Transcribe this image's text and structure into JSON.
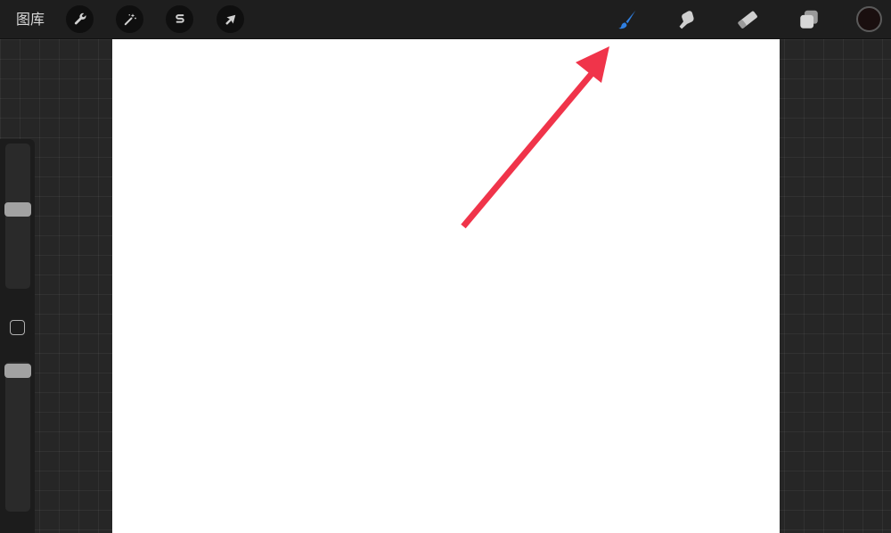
{
  "toolbar": {
    "gallery_label": "图库",
    "actions_icon": "wrench-icon",
    "adjustments_icon": "magic-wand-icon",
    "selection_icon": "s-selection-icon",
    "transform_icon": "arrow-cursor-icon",
    "brush_icon": "brush-icon",
    "smudge_icon": "smudge-icon",
    "eraser_icon": "eraser-icon",
    "layers_icon": "layers-icon",
    "active_tool": "brush",
    "active_color": "#1a0f0f",
    "accent_color": "#2f7fe0"
  },
  "sidebar": {
    "size_slider_level": 0.55,
    "opacity_slider_level": 1.0,
    "modify_button_icon": "rounded-square-icon"
  },
  "annotation": {
    "arrow_color": "#f0344a",
    "points_to": "brush-tool"
  }
}
